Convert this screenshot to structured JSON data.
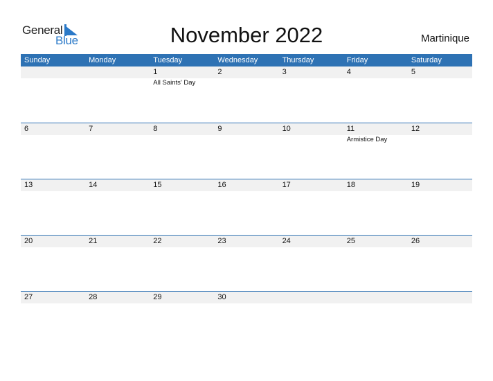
{
  "logo": {
    "part1": "General",
    "part2": "Blue"
  },
  "title": "November 2022",
  "country": "Martinique",
  "weekdays": [
    "Sunday",
    "Monday",
    "Tuesday",
    "Wednesday",
    "Thursday",
    "Friday",
    "Saturday"
  ],
  "weeks": [
    {
      "days": [
        "",
        "",
        "1",
        "2",
        "3",
        "4",
        "5"
      ],
      "events": [
        "",
        "",
        "All Saints' Day",
        "",
        "",
        "",
        ""
      ]
    },
    {
      "days": [
        "6",
        "7",
        "8",
        "9",
        "10",
        "11",
        "12"
      ],
      "events": [
        "",
        "",
        "",
        "",
        "",
        "Armistice Day",
        ""
      ]
    },
    {
      "days": [
        "13",
        "14",
        "15",
        "16",
        "17",
        "18",
        "19"
      ],
      "events": [
        "",
        "",
        "",
        "",
        "",
        "",
        ""
      ]
    },
    {
      "days": [
        "20",
        "21",
        "22",
        "23",
        "24",
        "25",
        "26"
      ],
      "events": [
        "",
        "",
        "",
        "",
        "",
        "",
        ""
      ]
    },
    {
      "days": [
        "27",
        "28",
        "29",
        "30",
        "",
        "",
        ""
      ],
      "events": [
        "",
        "",
        "",
        "",
        "",
        "",
        ""
      ]
    }
  ],
  "colors": {
    "accent": "#2e72b4",
    "brand_blue": "#2a79c8",
    "strip": "#f1f1f1"
  }
}
